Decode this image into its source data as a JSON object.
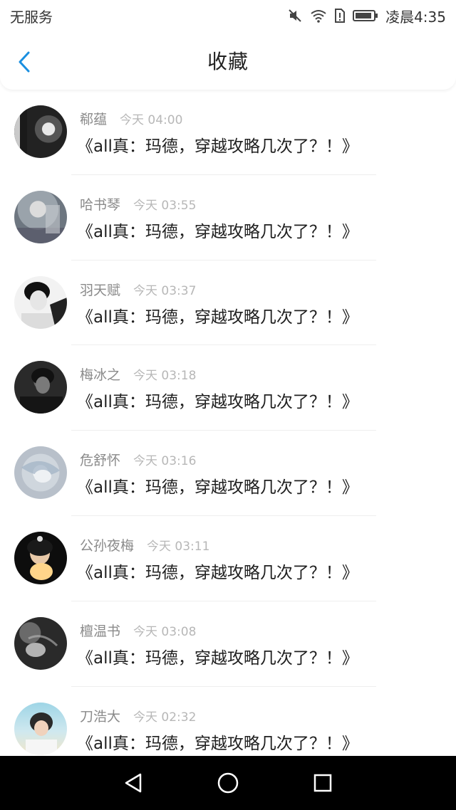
{
  "status_bar": {
    "carrier": "无服务",
    "time": "凌晨4:35",
    "icons": [
      "mute-icon",
      "wifi-icon",
      "alert-sim-icon",
      "battery-icon"
    ]
  },
  "header": {
    "title": "收藏",
    "back_icon": "chevron-left-icon",
    "accent_color": "#1a8fe0"
  },
  "favorites": [
    {
      "author": "郗蕴",
      "time": "今天 04:00",
      "title": "《all真：玛德，穿越攻略几次了？！》"
    },
    {
      "author": "哈书琴",
      "time": "今天 03:55",
      "title": "《all真：玛德，穿越攻略几次了？！》"
    },
    {
      "author": "羽天赋",
      "time": "今天 03:37",
      "title": "《all真：玛德，穿越攻略几次了？！》"
    },
    {
      "author": "梅冰之",
      "time": "今天 03:18",
      "title": "《all真：玛德，穿越攻略几次了？！》"
    },
    {
      "author": "危舒怀",
      "time": "今天 03:16",
      "title": "《all真：玛德，穿越攻略几次了？！》"
    },
    {
      "author": "公孙夜梅",
      "time": "今天 03:11",
      "title": "《all真：玛德，穿越攻略几次了？！》"
    },
    {
      "author": "檀温书",
      "time": "今天 03:08",
      "title": "《all真：玛德，穿越攻略几次了？！》"
    },
    {
      "author": "刀浩大",
      "time": "今天 02:32",
      "title": "《all真：玛德，穿越攻略几次了？！》"
    }
  ],
  "nav_bar": {
    "buttons": [
      "back-triangle-icon",
      "home-circle-icon",
      "recents-square-icon"
    ]
  }
}
